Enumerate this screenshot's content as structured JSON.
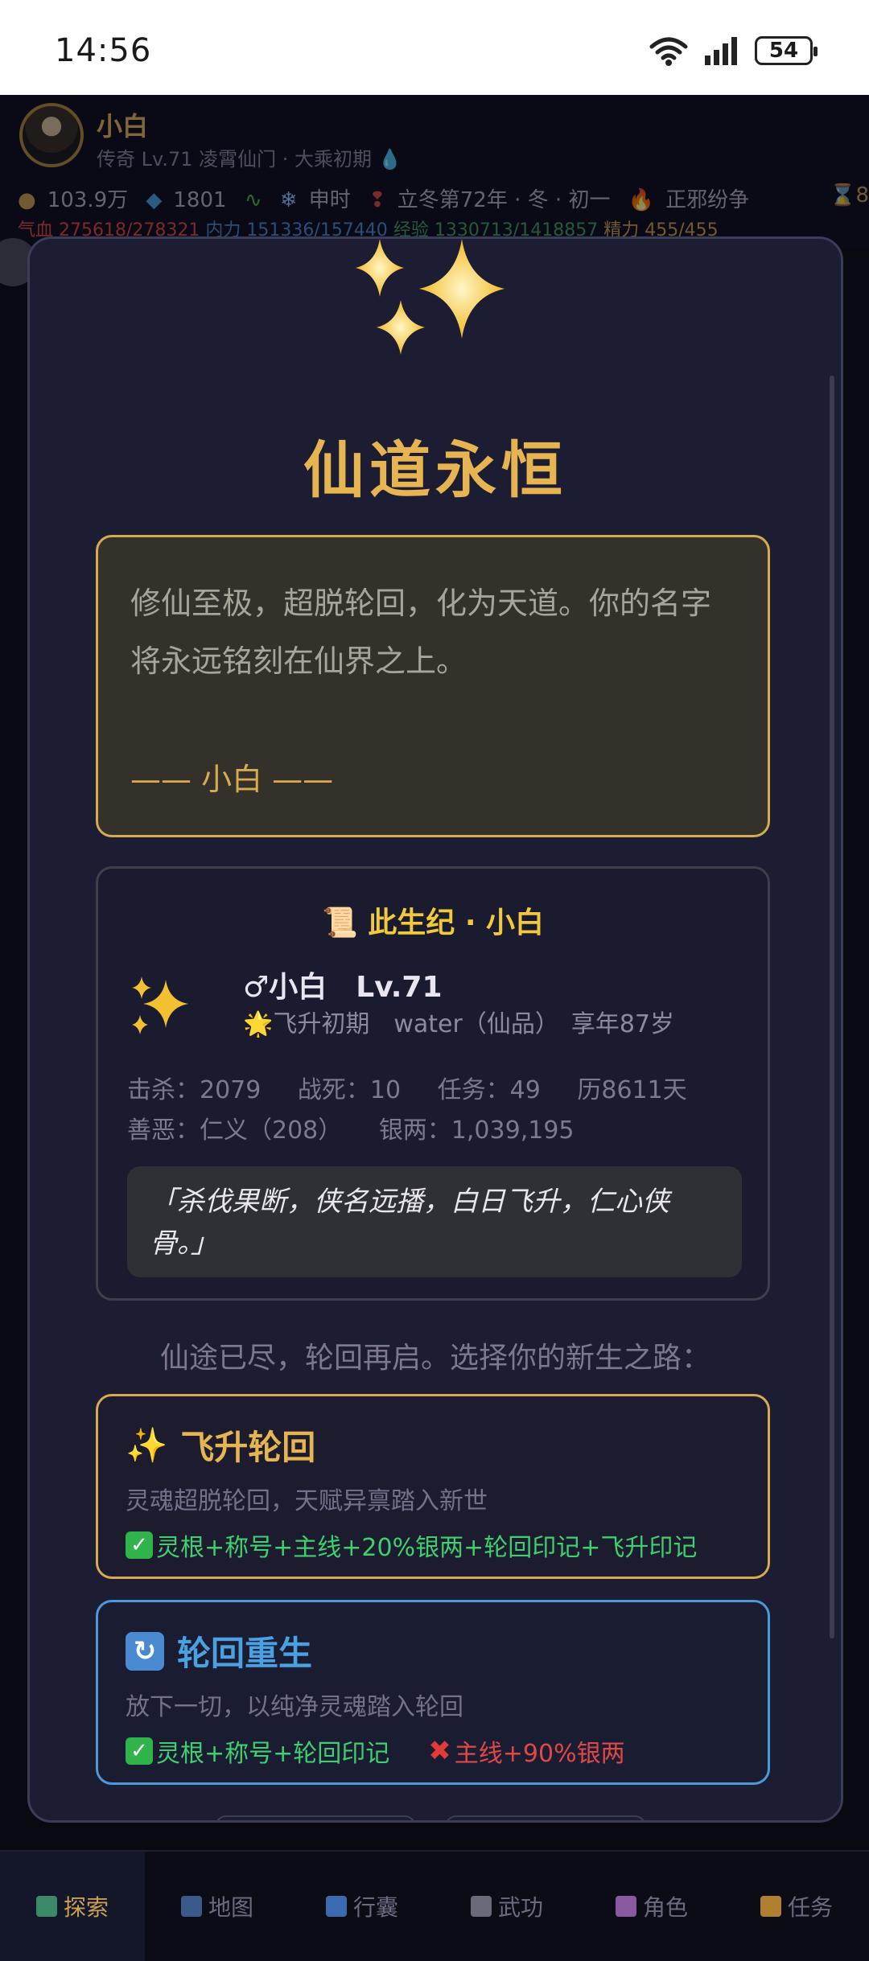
{
  "statusbar": {
    "time": "14:56",
    "battery": "54"
  },
  "player": {
    "name": "小白",
    "rank_line": "传奇 Lv.71 凌霄仙门 · 大乘初期",
    "resources": [
      "103.9万",
      "1801",
      "申时",
      "立冬第72年 · 冬 · 初一",
      "正邪纷争"
    ],
    "hourglass": "8",
    "stats": {
      "hp_label": "气血",
      "hp": "275618/278321",
      "mp_label": "内力",
      "mp": "151336/157440",
      "exp_label": "经验",
      "exp": "1330713/1418857",
      "energy_label": "精力",
      "energy": "455/455"
    }
  },
  "modal": {
    "title": "仙道永恒",
    "quote": "修仙至极，超脱轮回，化为天道。你的名字将永远铭刻在仙界之上。",
    "signature": "—— 小白 ——",
    "chronicle": {
      "title": "📜 此生纪 · 小白",
      "name_line": "♂小白　Lv.71",
      "sub_line": "🌟飞升初期　water（仙品）　享年87岁",
      "stats_row1": [
        "击杀：2079",
        "战死：10",
        "任务：49",
        "历8611天"
      ],
      "stats_row2": [
        "善恶：仁义（208）",
        "银两：1,039,195"
      ],
      "epitaph": "「杀伐果断，侠名远播，白日飞升，仁心侠骨。」"
    },
    "prompt": "仙途已尽，轮回再启。选择你的新生之路：",
    "options": [
      {
        "title": "飞升轮回",
        "desc": "灵魂超脱轮回，天赋异禀踏入新世",
        "gain": "灵根+称号+主线+20%银两+轮回印记+飞升印记",
        "loss": ""
      },
      {
        "title": "轮回重生",
        "desc": "放下一切，以纯净灵魂踏入轮回",
        "gain": "灵根+称号+轮回印记",
        "loss": "主线+90%银两"
      }
    ]
  },
  "nav": [
    "探索",
    "地图",
    "行囊",
    "武功",
    "角色",
    "任务"
  ],
  "colors": {
    "gold": "#e6b552",
    "blue": "#4aa0e0",
    "green": "#3ed070",
    "red": "#e04848"
  }
}
